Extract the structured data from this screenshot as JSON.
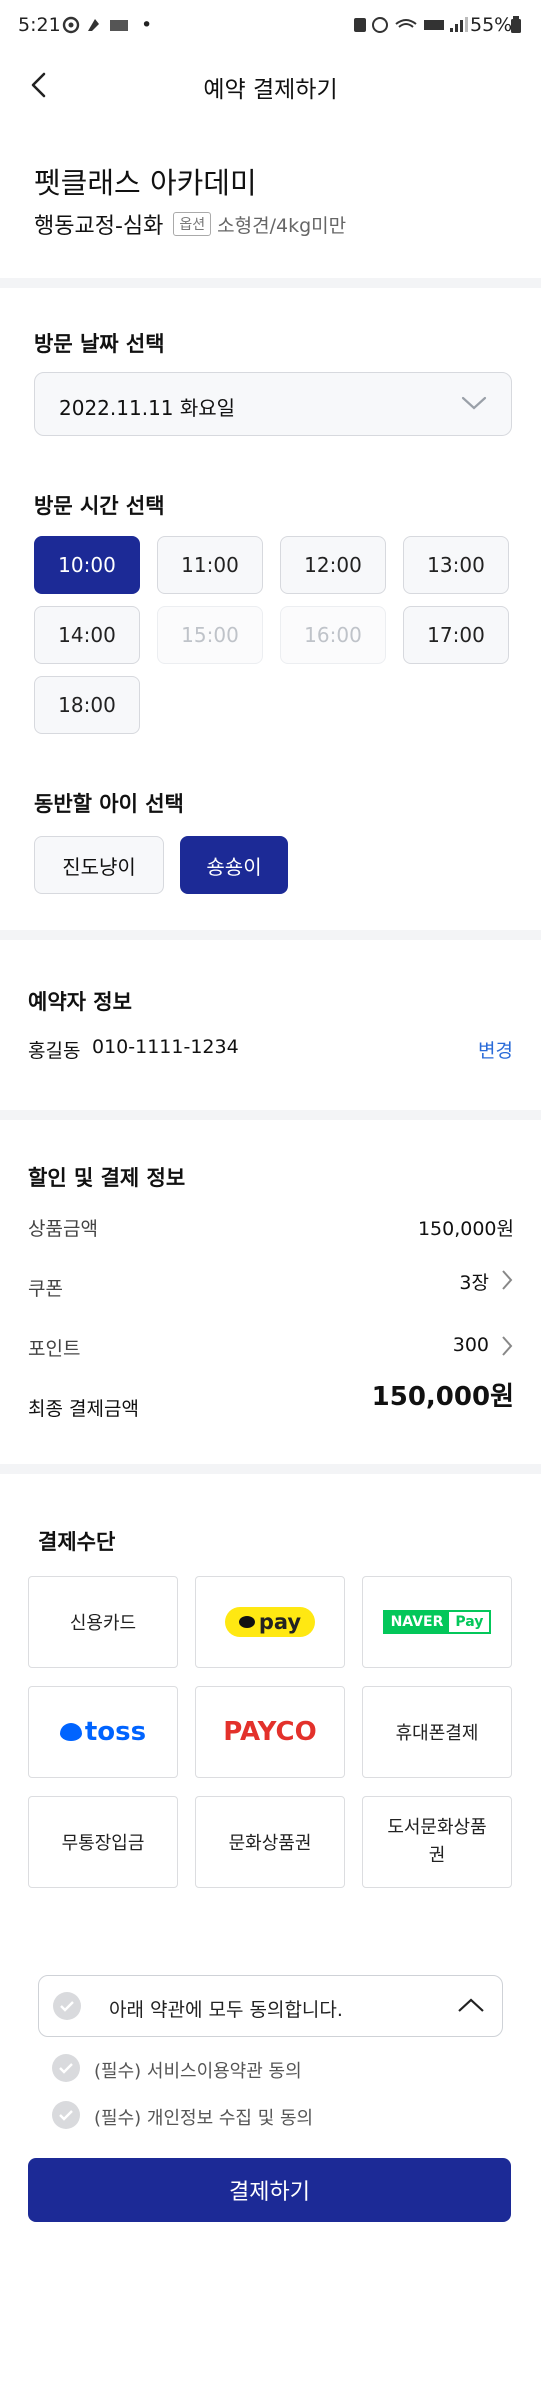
{
  "status_bar": {
    "time": "5:21",
    "dot": "•",
    "battery": "55%"
  },
  "header": {
    "title": "예약 결제하기"
  },
  "product": {
    "shop_name": "펫클래스 아카데미",
    "class_name": "행동교정-심화",
    "option_badge": "옵션",
    "option_text": "소형견/4kg미만"
  },
  "visit_date": {
    "title": "방문 날짜 선택",
    "value": "2022.11.11 화요일"
  },
  "visit_time": {
    "title": "방문 시간 선택",
    "slots": [
      {
        "label": "10:00",
        "state": "selected"
      },
      {
        "label": "11:00",
        "state": "available"
      },
      {
        "label": "12:00",
        "state": "available"
      },
      {
        "label": "13:00",
        "state": "available"
      },
      {
        "label": "14:00",
        "state": "available"
      },
      {
        "label": "15:00",
        "state": "disabled"
      },
      {
        "label": "16:00",
        "state": "disabled"
      },
      {
        "label": "17:00",
        "state": "available"
      },
      {
        "label": "18:00",
        "state": "available"
      }
    ]
  },
  "pet_select": {
    "title": "동반할 아이 선택",
    "pets": [
      "진도냥이",
      "숑숑이"
    ],
    "selected": "숑숑이"
  },
  "booker": {
    "title": "예약자 정보",
    "name": "홍길동",
    "phone": "010-1111-1234",
    "change_label": "변경"
  },
  "payment_info": {
    "title": "할인 및 결제 정보",
    "product_amount_label": "상품금액",
    "product_amount": "150,000원",
    "coupon_label": "쿠폰",
    "coupon_value": "3장",
    "point_label": "포인트",
    "point_value": "300",
    "final_label": "최종 결제금액",
    "final_value": "150,000원"
  },
  "payment_method": {
    "title": "결제수단",
    "credit_card": "신용카드",
    "kakao_pay": "pay",
    "naver_pay_naver": "NAVER",
    "naver_pay_pay": "Pay",
    "toss": "toss",
    "payco": "PAYCO",
    "phone": "휴대폰결제",
    "bank_transfer": "무통장입금",
    "culture_gift": "문화상품권",
    "book_gift_line1": "도서문화상품",
    "book_gift_line2": "권"
  },
  "agreement": {
    "all_label": "아래 약관에 모두 동의합니다.",
    "items": [
      "(필수) 서비스이용약관 동의",
      "(필수) 개인정보 수집 및 동의"
    ]
  },
  "pay_button": "결제하기",
  "colors": {
    "primary": "#1c2a96",
    "link": "#2a6bd8",
    "kakao": "#ffe812",
    "naver": "#03c75a",
    "toss": "#0064ff",
    "payco": "#e3312b"
  }
}
